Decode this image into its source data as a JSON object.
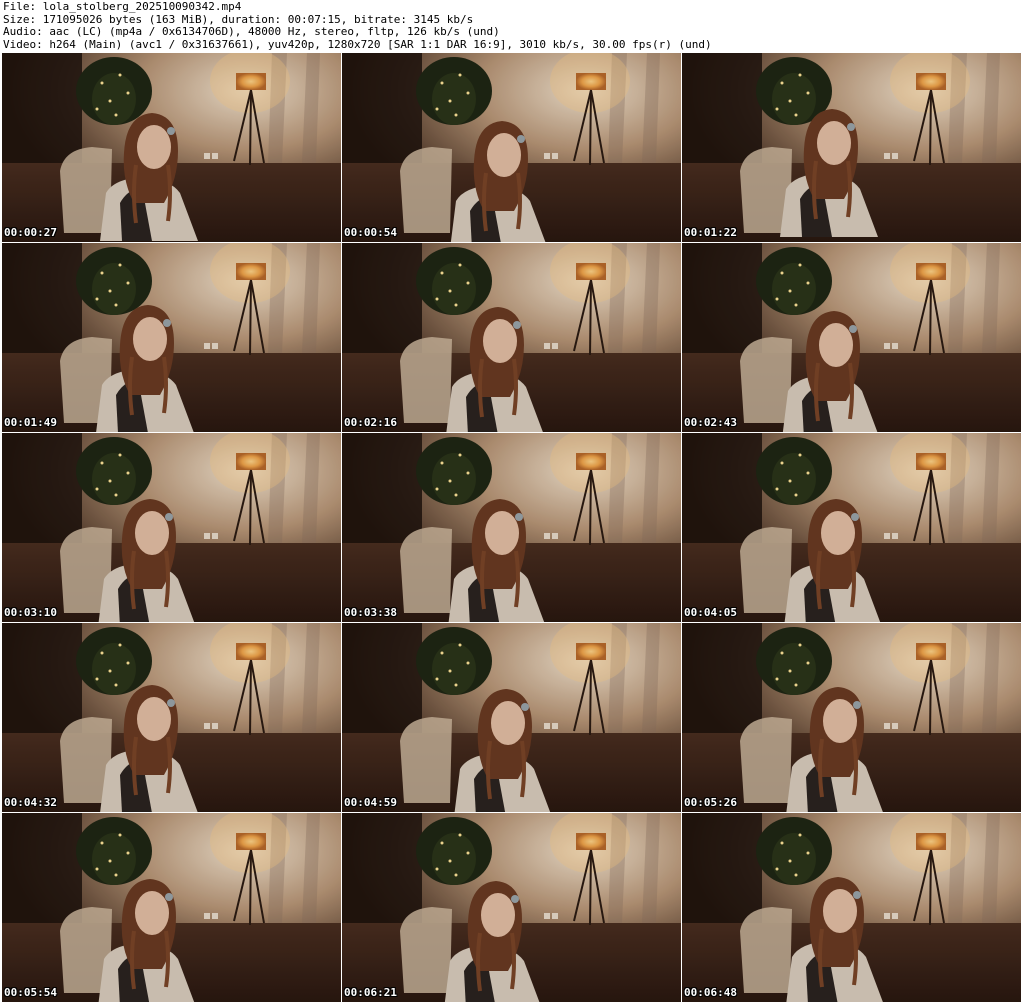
{
  "header": {
    "file_line": "File: lola_stolberg_202510090342.mp4",
    "size_line": "Size: 171095026 bytes (163 MiB), duration: 00:07:15, bitrate: 3145 kb/s",
    "audio_line": "Audio: aac (LC) (mp4a / 0x6134706D), 48000 Hz, stereo, fltp, 126 kb/s (und)",
    "video_line": "Video: h264 (Main) (avc1 / 0x31637661), yuv420p, 1280x720 [SAR 1:1 DAR 16:9], 3010 kb/s, 30.00 fps(r) (und)"
  },
  "thumbnails": [
    {
      "timestamp": "00:00:27"
    },
    {
      "timestamp": "00:00:54"
    },
    {
      "timestamp": "00:01:22"
    },
    {
      "timestamp": "00:01:49"
    },
    {
      "timestamp": "00:02:16"
    },
    {
      "timestamp": "00:02:43"
    },
    {
      "timestamp": "00:03:10"
    },
    {
      "timestamp": "00:03:38"
    },
    {
      "timestamp": "00:04:05"
    },
    {
      "timestamp": "00:04:32"
    },
    {
      "timestamp": "00:04:59"
    },
    {
      "timestamp": "00:05:26"
    },
    {
      "timestamp": "00:05:54"
    },
    {
      "timestamp": "00:06:21"
    },
    {
      "timestamp": "00:06:48"
    }
  ]
}
